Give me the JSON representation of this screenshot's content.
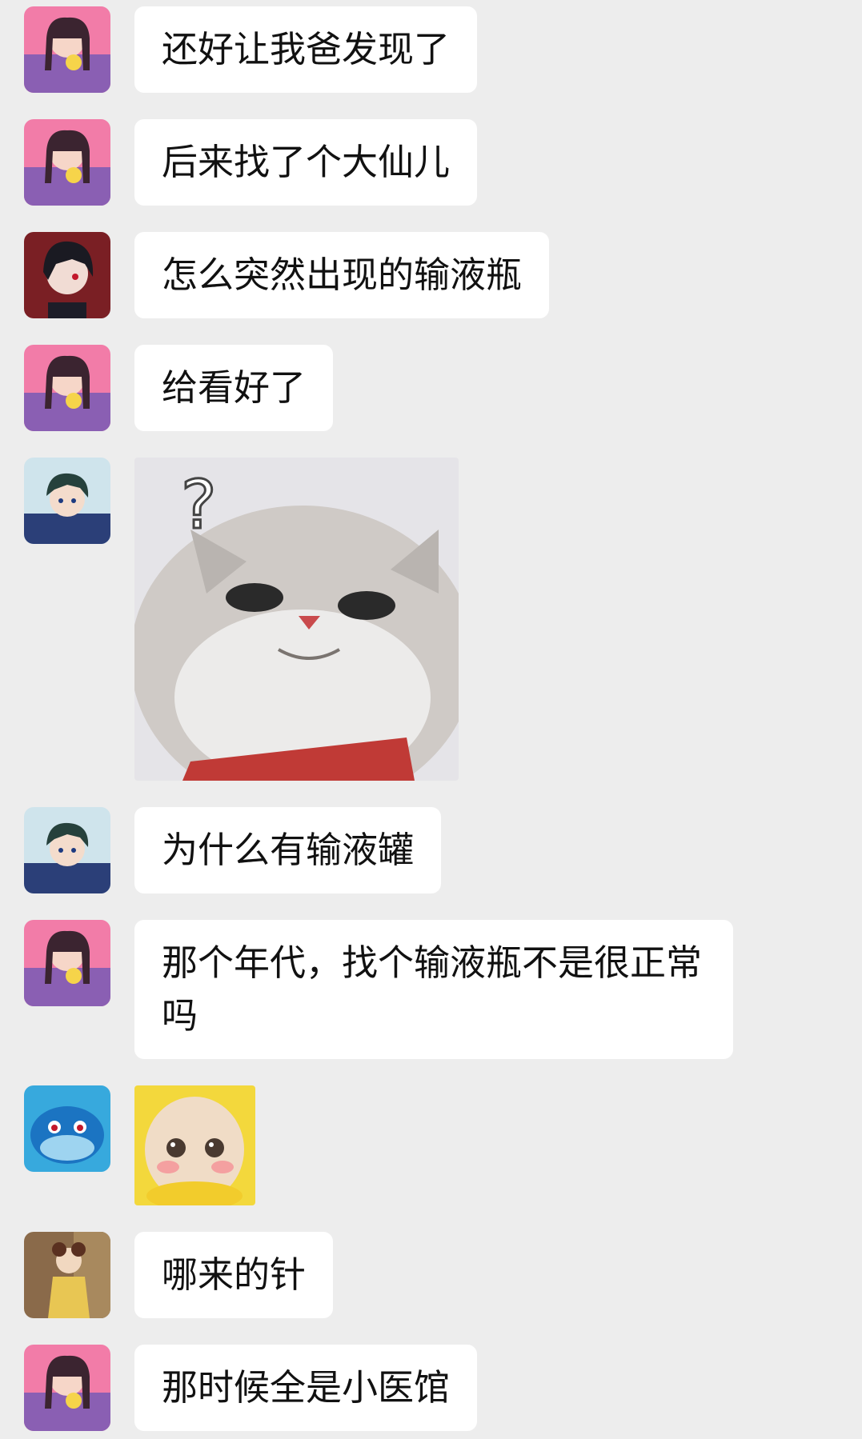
{
  "messages": [
    {
      "sender": "girl",
      "text": "还好让我爸发现了"
    },
    {
      "sender": "girl",
      "text": "后来找了个大仙儿"
    },
    {
      "sender": "boy-dark",
      "text": "怎么突然出现的输液瓶"
    },
    {
      "sender": "girl",
      "text": "给看好了"
    },
    {
      "sender": "boy-blue",
      "sticker": "cat-question-sticker"
    },
    {
      "sender": "boy-blue",
      "text": "为什么有输液罐"
    },
    {
      "sender": "girl",
      "text": "那个年代，找个输液瓶不是很正常吗"
    },
    {
      "sender": "whale",
      "sticker": "teletubby-sticker"
    },
    {
      "sender": "lady-yellow",
      "text": "哪来的针"
    },
    {
      "sender": "girl",
      "text": "那时候全是小医馆"
    }
  ],
  "colors": {
    "background": "#ededed",
    "bubble": "#ffffff",
    "text": "#111111"
  }
}
